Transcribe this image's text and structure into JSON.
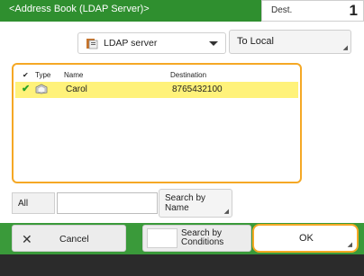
{
  "header": {
    "title": "<Address Book (LDAP Server)>",
    "dest_label": "Dest.",
    "dest_count": "1"
  },
  "toolbar": {
    "source_value": "LDAP server",
    "source_icon": "address-book-icon",
    "to_local_label": "To Local"
  },
  "list": {
    "columns": {
      "check": "✔",
      "type": "Type",
      "name": "Name",
      "destination": "Destination"
    },
    "rows": [
      {
        "checked": "✔",
        "type_icon": "group-icon",
        "name": "Carol",
        "destination": "8765432100"
      }
    ]
  },
  "search_row": {
    "all_label": "All",
    "search_value": "",
    "search_by_name_label": "Search by Name"
  },
  "footer": {
    "cancel_label": "Cancel",
    "search_by_conditions_label": "Search by Conditions",
    "ok_label": "OK"
  },
  "colors": {
    "accent_green": "#2f8f2f",
    "selection_yellow": "#fff27a",
    "focus_orange": "#f5a825"
  }
}
